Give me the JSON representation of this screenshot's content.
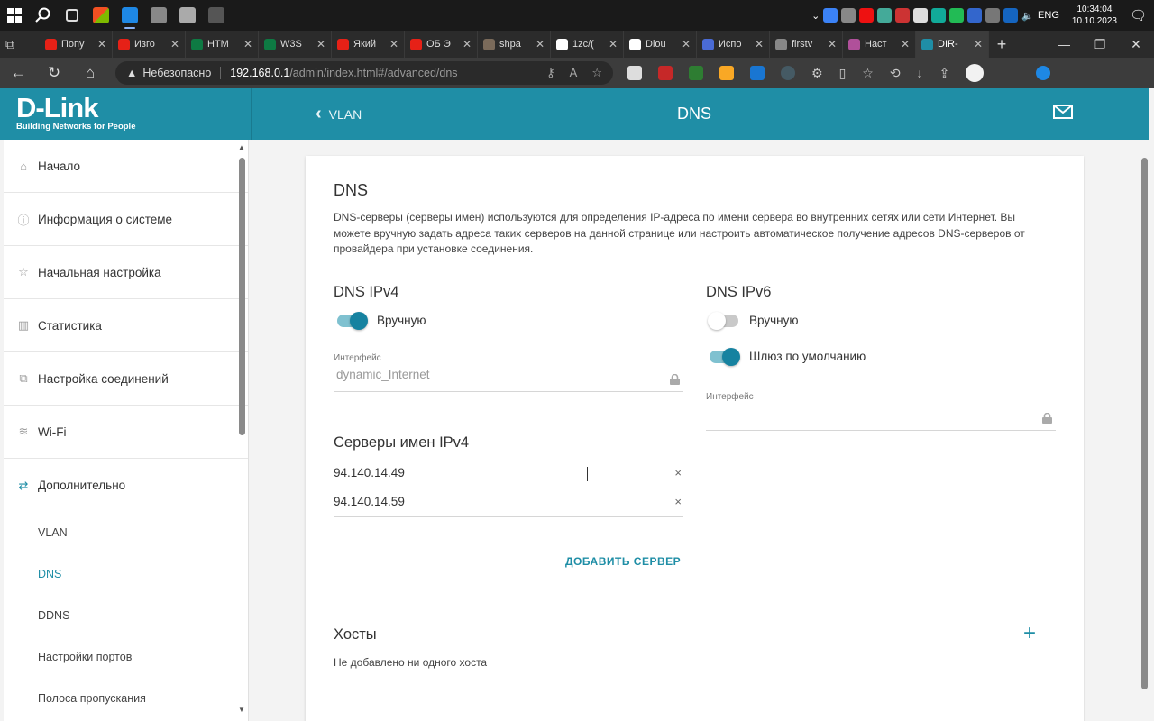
{
  "taskbar": {
    "clock_time": "10:34:04",
    "clock_date": "10.10.2023",
    "lang": "ENG"
  },
  "tabs": [
    {
      "label": "Попу",
      "color": "#e62117",
      "icon": "youtube-icon"
    },
    {
      "label": "Изго",
      "color": "#e62117",
      "icon": "youtube-icon"
    },
    {
      "label": "HTM",
      "color": "#0e7a43",
      "icon": "w3schools-icon"
    },
    {
      "label": "W3S",
      "color": "#0e7a43",
      "icon": "w3schools-icon"
    },
    {
      "label": "Який",
      "color": "#e62117",
      "icon": "youtube-icon"
    },
    {
      "label": "ОБ Э",
      "color": "#e62117",
      "icon": "youtube-icon"
    },
    {
      "label": "shpa",
      "color": "#7a6a5a",
      "icon": "gear-icon"
    },
    {
      "label": "1zc/(",
      "color": "#ffffff",
      "icon": "github-icon"
    },
    {
      "label": "Diou",
      "color": "#ffffff",
      "icon": "github-icon"
    },
    {
      "label": "Испо",
      "color": "#4a6bd6",
      "icon": "site-icon"
    },
    {
      "label": "firstv",
      "color": "#888888",
      "icon": "page-icon"
    },
    {
      "label": "Наст",
      "color": "#b0509a",
      "icon": "site-icon"
    },
    {
      "label": "DIR-",
      "color": "#1f8ea6",
      "icon": "dlink-icon",
      "active": true
    }
  ],
  "address": {
    "warning": "Небезопасно",
    "host": "192.168.0.1",
    "path": "/admin/index.html#/advanced/dns"
  },
  "header": {
    "logo": "D-Link",
    "tagline": "Building Networks for People",
    "back_label": "VLAN",
    "title": "DNS"
  },
  "sidebar": {
    "items": [
      {
        "label": "Начало",
        "icon": "home-icon",
        "glyph": "⌂"
      },
      {
        "label": "Информация о системе",
        "icon": "info-icon",
        "glyph": "ⓘ"
      },
      {
        "label": "Начальная настройка",
        "icon": "wizard-icon",
        "glyph": "☆"
      },
      {
        "label": "Статистика",
        "icon": "chart-icon",
        "glyph": "▥"
      },
      {
        "label": "Настройка соединений",
        "icon": "connections-icon",
        "glyph": "⧉"
      },
      {
        "label": "Wi-Fi",
        "icon": "wifi-icon",
        "glyph": "≋"
      },
      {
        "label": "Дополнительно",
        "icon": "advanced-icon",
        "glyph": "⇄"
      }
    ],
    "subitems": [
      "VLAN",
      "DNS",
      "DDNS",
      "Настройки портов",
      "Полоса пропускания"
    ]
  },
  "card": {
    "title": "DNS",
    "description": "DNS-серверы (серверы имен) используются для определения IP-адреса по имени сервера во внутренних сетях или сети Интернет. Вы можете вручную задать адреса таких серверов на данной странице или настроить автоматическое получение адресов DNS-серверов от провайдера при установке соединения.",
    "ipv4": {
      "title": "DNS IPv4",
      "manual_label": "Вручную",
      "manual_on": true,
      "iface_label": "Интерфейс",
      "iface_value": "dynamic_Internet"
    },
    "ipv6": {
      "title": "DNS IPv6",
      "manual_label": "Вручную",
      "manual_on": false,
      "gateway_label": "Шлюз по умолчанию",
      "gateway_on": true,
      "iface_label": "Интерфейс",
      "iface_value": ""
    },
    "servers_title": "Серверы имен IPv4",
    "servers": [
      "94.140.14.49",
      "94.140.14.59"
    ],
    "clear_glyph": "×",
    "add_server": "ДОБАВИТЬ СЕРВЕР",
    "hosts_title": "Хосты",
    "hosts_empty": "Не добавлено ни одного хоста"
  }
}
